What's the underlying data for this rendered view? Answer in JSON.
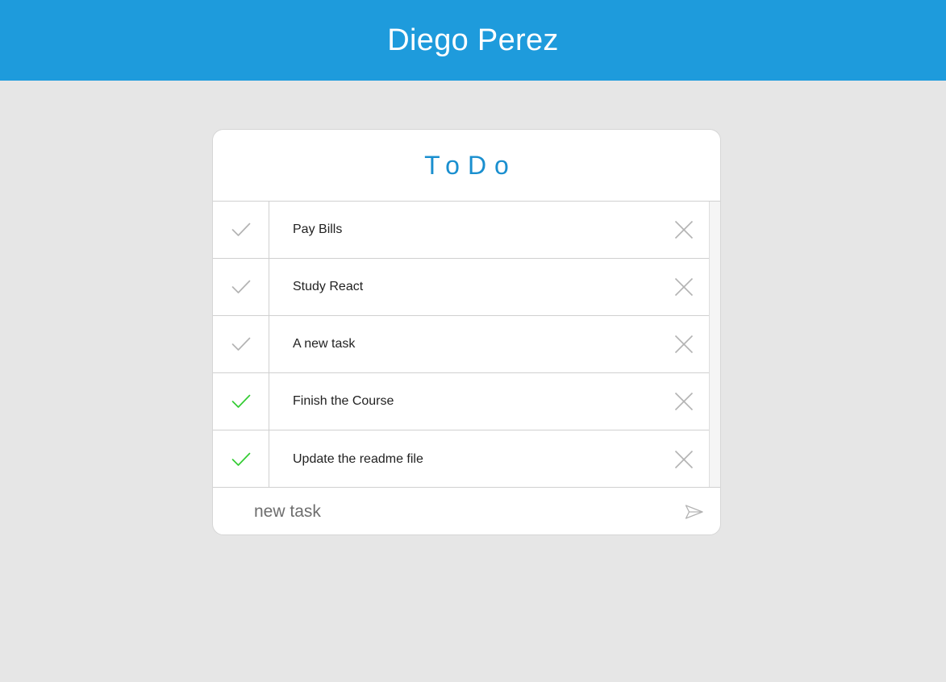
{
  "header": {
    "title": "Diego Perez",
    "background_color": "#1e9bdc"
  },
  "card": {
    "title": "ToDo",
    "title_color": "#1a8fcf"
  },
  "tasks": [
    {
      "label": "Pay Bills",
      "done": false,
      "check_icon": "check-icon",
      "delete_icon": "close-icon"
    },
    {
      "label": "Study React",
      "done": false,
      "check_icon": "check-icon",
      "delete_icon": "close-icon"
    },
    {
      "label": "A new task",
      "done": false,
      "check_icon": "check-icon",
      "delete_icon": "close-icon"
    },
    {
      "label": "Finish the Course",
      "done": true,
      "check_icon": "check-icon",
      "delete_icon": "close-icon"
    },
    {
      "label": "Update the readme file",
      "done": true,
      "check_icon": "check-icon",
      "delete_icon": "close-icon"
    }
  ],
  "composer": {
    "placeholder": "new task",
    "value": "",
    "send_icon": "send-icon"
  },
  "colors": {
    "done_check": "#33cc33",
    "pending_check": "#b3b3b3",
    "delete_icon": "#b3b3b3",
    "send_icon": "#b3b3b3"
  }
}
